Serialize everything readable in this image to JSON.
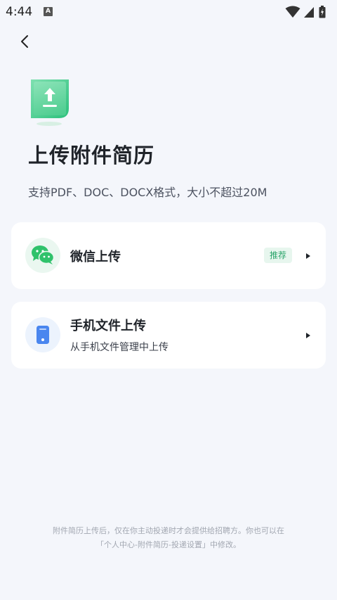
{
  "status_bar": {
    "time": "4:44",
    "notification_icon": "A"
  },
  "header": {
    "back_icon": "chevron-left-icon",
    "title": "上传附件简历",
    "subtitle": "支持PDF、DOC、DOCX格式，大小不超过20M"
  },
  "options": [
    {
      "title": "微信上传",
      "badge": "推荐",
      "icon": "wechat-icon",
      "icon_color": "#2fc26b"
    },
    {
      "title": "手机文件上传",
      "description": "从手机文件管理中上传",
      "icon": "phone-icon",
      "icon_color": "#4a86ef"
    }
  ],
  "footer": {
    "line1": "附件简历上传后，仅在你主动投递时才会提供给招聘方。你也可以在",
    "line2": "「个人中心-附件简历-投递设置」中修改。"
  },
  "colors": {
    "accent_green": "#2fc26b",
    "accent_blue": "#4a86ef",
    "background": "#f4f6fb"
  }
}
